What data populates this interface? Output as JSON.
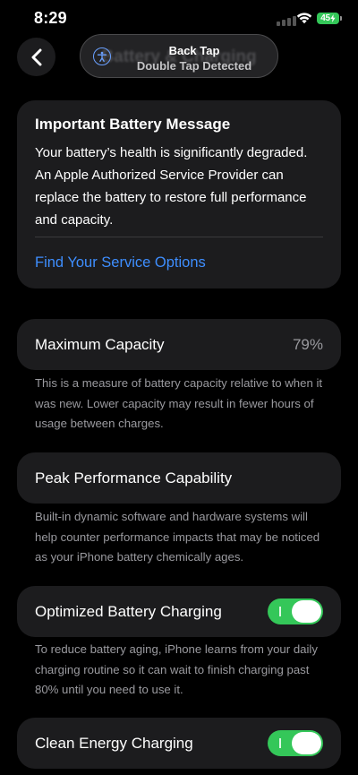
{
  "status_bar": {
    "time": "8:29",
    "battery_level": "45",
    "accent_color": "#34c759"
  },
  "banner": {
    "title": "Back Tap",
    "subtitle": "Double Tap Detected",
    "background_text": "Battery & Charging",
    "icon": "accessibility-icon"
  },
  "message_card": {
    "title": "Important Battery Message",
    "body": "Your battery’s health is significantly degraded. An Apple Authorized Service Provider can replace the battery to restore full performance and capacity.",
    "link_label": "Find Your Service Options",
    "link_color": "#3e8eff"
  },
  "maximum_capacity": {
    "label": "Maximum Capacity",
    "value": "79%",
    "footnote": "This is a measure of battery capacity relative to when it was new. Lower capacity may result in fewer hours of usage between charges."
  },
  "peak_performance": {
    "label": "Peak Performance Capability",
    "footnote": "Built-in dynamic software and hardware systems will help counter performance impacts that may be noticed as your iPhone battery chemically ages."
  },
  "optimized_charging": {
    "label": "Optimized Battery Charging",
    "enabled": true,
    "footnote": "To reduce battery aging, iPhone learns from your daily charging routine so it can wait to finish charging past 80% until you need to use it."
  },
  "clean_energy": {
    "label": "Clean Energy Charging",
    "enabled": true
  }
}
